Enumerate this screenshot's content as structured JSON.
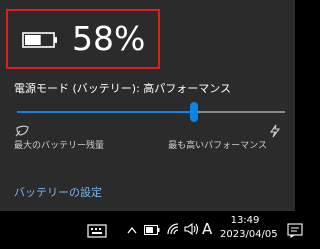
{
  "battery": {
    "percent_text": "58%",
    "level": 0.58
  },
  "power_mode": {
    "label": "電源モード (バッテリー): 高パフォーマンス",
    "slider_value": 0.66,
    "min_label": "最大のバッテリー残量",
    "max_label": "最も高いパフォーマンス"
  },
  "settings_link": "バッテリーの設定",
  "taskbar": {
    "ime_indicator": "A",
    "time": "13:49",
    "date": "2023/04/05",
    "icons": [
      "keyboard-icon",
      "chevron-up-icon",
      "battery-icon",
      "wifi-icon",
      "volume-icon",
      "notification-icon"
    ]
  },
  "colors": {
    "accent": "#0a84e6",
    "highlight_border": "#e01e1e",
    "link": "#79b4f2",
    "flyout_bg": "#2b2b2b"
  }
}
